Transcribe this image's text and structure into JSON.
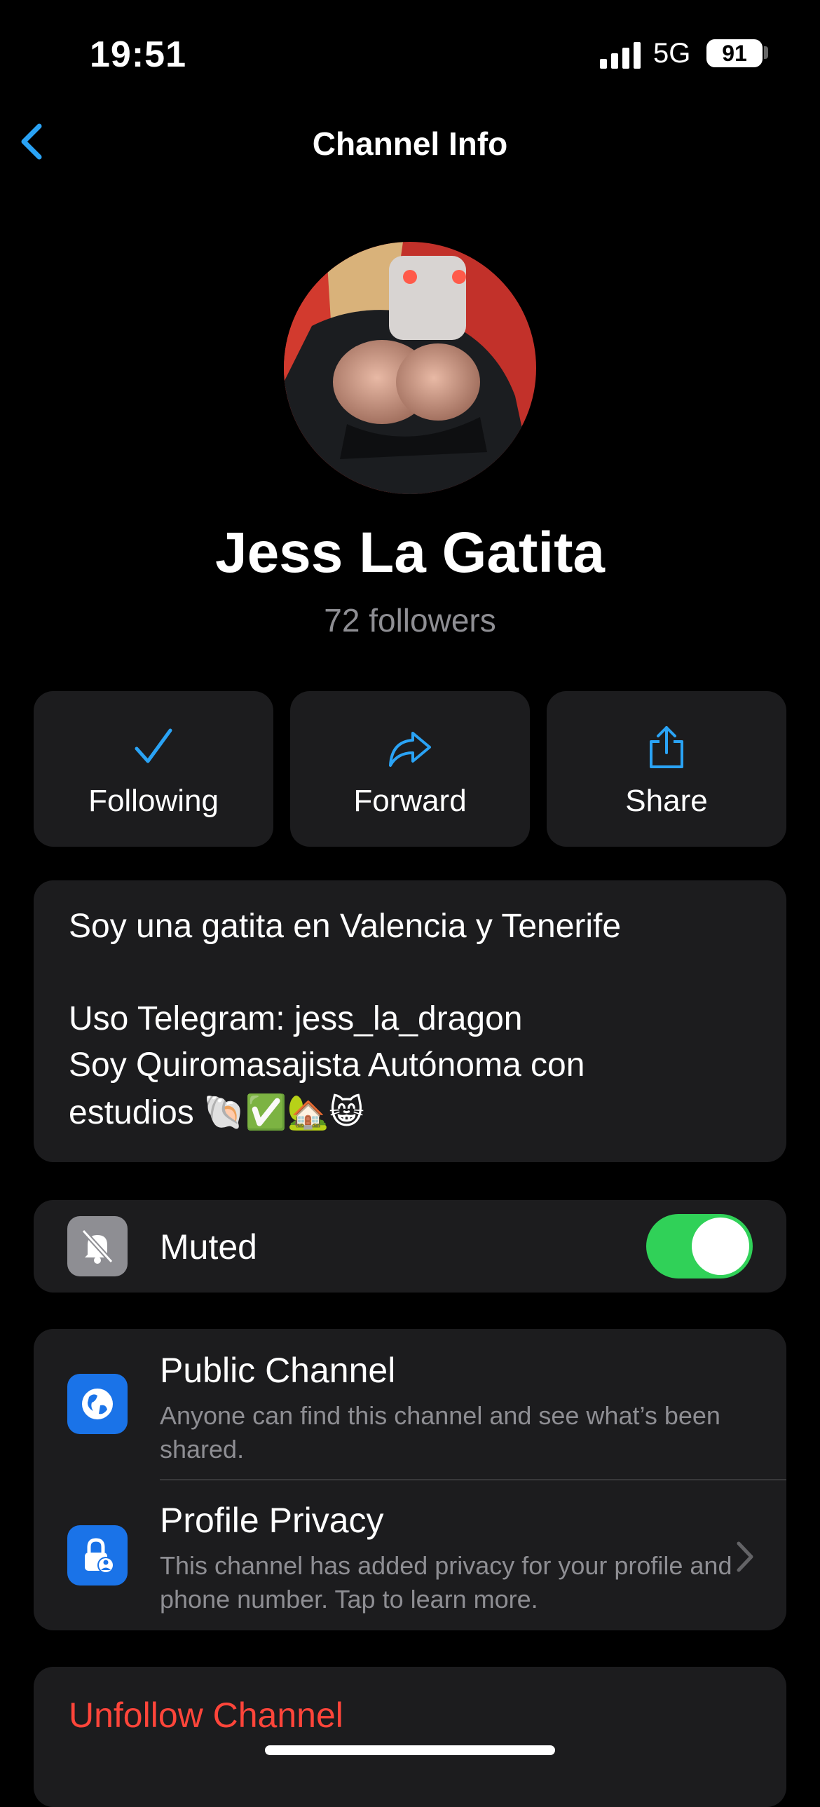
{
  "status_bar": {
    "time": "19:51",
    "network": "5G",
    "battery": "91"
  },
  "nav": {
    "title": "Channel Info"
  },
  "channel": {
    "name": "Jess La Gatita",
    "followers": "72 followers"
  },
  "actions": [
    {
      "label": "Following",
      "icon": "check-icon"
    },
    {
      "label": "Forward",
      "icon": "forward-arrow-icon"
    },
    {
      "label": "Share",
      "icon": "share-icon"
    }
  ],
  "about": {
    "line1": "Soy una gatita en Valencia y Tenerife",
    "line2": "Uso Telegram: jess_la_dragon",
    "line3": "Soy Quiromasajista Autónoma con",
    "line4": "estudios 🐚✅🏡😸"
  },
  "muted": {
    "label": "Muted",
    "enabled": true
  },
  "privacy": {
    "public_title": "Public Channel",
    "public_sub": "Anyone can find this channel and see what’s been shared.",
    "profile_title": "Profile Privacy",
    "profile_sub": "This channel has added privacy for your profile and phone number. Tap to learn more."
  },
  "unfollow": {
    "label": "Unfollow Channel"
  },
  "colors": {
    "accent": "#2aa3f5",
    "toggle_on": "#30d158",
    "destructive": "#ff453a",
    "card": "#1c1c1e"
  }
}
